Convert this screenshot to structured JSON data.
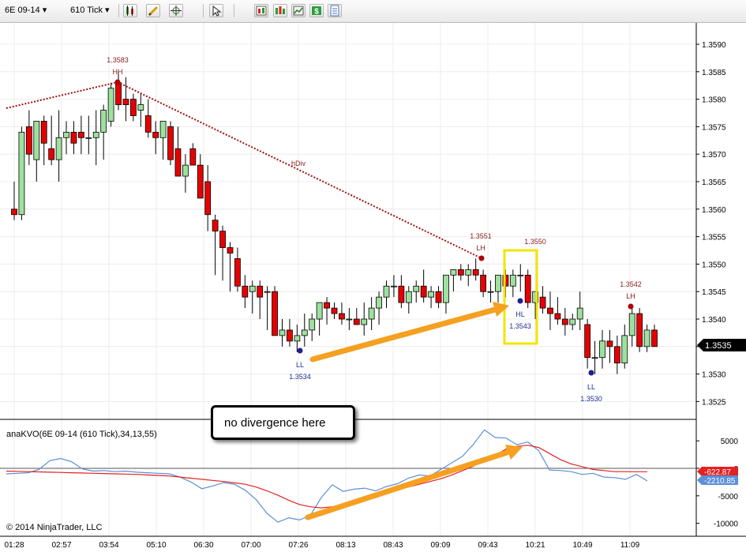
{
  "toolbar": {
    "instrument": "6E 09-14",
    "interval": "610 Tick",
    "icons": [
      "bars-icon",
      "pencil-icon",
      "crosshair-icon",
      "cursor-icon",
      "properties-icon",
      "indicators-icon",
      "strategies-icon",
      "dollar-icon",
      "data-box-icon"
    ]
  },
  "price_axis": {
    "labels": [
      "1.3590",
      "1.3585",
      "1.3580",
      "1.3575",
      "1.3570",
      "1.3565",
      "1.3560",
      "1.3555",
      "1.3550",
      "1.3545",
      "1.3540",
      "1.3535",
      "1.3530",
      "1.3525"
    ],
    "last_price": "1.3535"
  },
  "time_axis": {
    "labels": [
      "01:28",
      "02:57",
      "03:54",
      "05:10",
      "06:30",
      "07:00",
      "07:26",
      "08:13",
      "08:43",
      "09:09",
      "09:43",
      "10:21",
      "10:49",
      "11:09"
    ]
  },
  "indicator": {
    "title": "anaKVO(6E 09-14 (610 Tick),34,13,55)",
    "axis_labels": [
      "5000",
      "0",
      "-5000",
      "-10000"
    ],
    "value_tags": [
      "-622.87",
      "-2210.85"
    ]
  },
  "copyright": "© 2014 NinjaTrader, LLC",
  "callout_text": "no divergence here",
  "annotations": {
    "hh": {
      "value": "1.3583",
      "tag": "HH"
    },
    "ll1": {
      "value": "1.3534",
      "tag": "LL"
    },
    "lh1": {
      "value": "1.3551",
      "tag": "LH"
    },
    "lh2": {
      "value": "1.3550",
      "tag": ""
    },
    "hl": {
      "value": "1.3543",
      "tag": "HL"
    },
    "ll2": {
      "value": "1.3530",
      "tag": "LL"
    },
    "lh3": {
      "value": "1.3542",
      "tag": "LH"
    },
    "div": "hDiv"
  },
  "colors": {
    "up": "#9fe09f",
    "down": "#e60000",
    "kvo": "#5b8fd9",
    "signal": "#e32222",
    "arrow": "#f5a020",
    "highlight": "#f4e400",
    "hh_marker": "#b00000",
    "ll_marker": "#1f1f8f",
    "div_line": "#a01010"
  },
  "chart_data": [
    {
      "type": "candlestick",
      "title": "6E 09-14 610 Tick",
      "ylim": [
        1.3521,
        1.3593
      ],
      "candles": [
        [
          1.356,
          1.3565,
          1.3558,
          1.3559
        ],
        [
          1.3559,
          1.3575,
          1.3558,
          1.3574
        ],
        [
          1.3575,
          1.3578,
          1.3568,
          1.357
        ],
        [
          1.3569,
          1.3576,
          1.3565,
          1.3576
        ],
        [
          1.3576,
          1.3577,
          1.3568,
          1.3572
        ],
        [
          1.3571,
          1.3577,
          1.3568,
          1.3569
        ],
        [
          1.3569,
          1.3578,
          1.3565,
          1.3573
        ],
        [
          1.3573,
          1.3576,
          1.357,
          1.3574
        ],
        [
          1.3574,
          1.3576,
          1.357,
          1.3572
        ],
        [
          1.3574,
          1.3577,
          1.357,
          1.3573
        ],
        [
          1.3573,
          1.3577,
          1.357,
          1.3573
        ],
        [
          1.3573,
          1.3578,
          1.3568,
          1.3574
        ],
        [
          1.3574,
          1.3579,
          1.3569,
          1.3578
        ],
        [
          1.3576,
          1.3583,
          1.3575,
          1.3582
        ],
        [
          1.3583,
          1.3585,
          1.3578,
          1.3579
        ],
        [
          1.358,
          1.3584,
          1.3576,
          1.3579
        ],
        [
          1.358,
          1.3581,
          1.3576,
          1.3577
        ],
        [
          1.3578,
          1.3581,
          1.3575,
          1.3579
        ],
        [
          1.3577,
          1.358,
          1.3573,
          1.3574
        ],
        [
          1.3574,
          1.3576,
          1.357,
          1.3573
        ],
        [
          1.3573,
          1.3576,
          1.3569,
          1.3576
        ],
        [
          1.3575,
          1.3576,
          1.3568,
          1.3569
        ],
        [
          1.3571,
          1.3575,
          1.3566,
          1.3566
        ],
        [
          1.3566,
          1.357,
          1.3563,
          1.3568
        ],
        [
          1.3571,
          1.3572,
          1.3569,
          1.3568
        ],
        [
          1.3568,
          1.357,
          1.3565,
          1.3562
        ],
        [
          1.3565,
          1.3568,
          1.3556,
          1.3559
        ],
        [
          1.3558,
          1.3559,
          1.3548,
          1.3556
        ],
        [
          1.3556,
          1.3557,
          1.3547,
          1.3553
        ],
        [
          1.3553,
          1.3554,
          1.3545,
          1.3552
        ],
        [
          1.3551,
          1.3553,
          1.3545,
          1.3546
        ],
        [
          1.3546,
          1.3548,
          1.3542,
          1.3544
        ],
        [
          1.3545,
          1.3547,
          1.3541,
          1.3546
        ],
        [
          1.3546,
          1.3547,
          1.354,
          1.3544
        ],
        [
          1.3545,
          1.3546,
          1.3538,
          1.3545
        ],
        [
          1.3545,
          1.3546,
          1.3538,
          1.3537
        ],
        [
          1.3537,
          1.354,
          1.3535,
          1.3538
        ],
        [
          1.3538,
          1.354,
          1.3535,
          1.3536
        ],
        [
          1.3536,
          1.3539,
          1.3534,
          1.3537
        ],
        [
          1.3537,
          1.3541,
          1.3535,
          1.3538
        ],
        [
          1.3538,
          1.3541,
          1.3536,
          1.354
        ],
        [
          1.354,
          1.3543,
          1.3537,
          1.3543
        ],
        [
          1.3543,
          1.3544,
          1.3539,
          1.3542
        ],
        [
          1.3542,
          1.3543,
          1.354,
          1.3541
        ],
        [
          1.3541,
          1.3543,
          1.3539,
          1.354
        ],
        [
          1.354,
          1.3542,
          1.3538,
          1.354
        ],
        [
          1.354,
          1.3542,
          1.3539,
          1.3539
        ],
        [
          1.3539,
          1.3543,
          1.3537,
          1.354
        ],
        [
          1.354,
          1.3544,
          1.3538,
          1.3542
        ],
        [
          1.3542,
          1.3545,
          1.3539,
          1.3544
        ],
        [
          1.3544,
          1.3547,
          1.3542,
          1.3546
        ],
        [
          1.3546,
          1.3548,
          1.3544,
          1.3546
        ],
        [
          1.3546,
          1.3548,
          1.3542,
          1.3543
        ],
        [
          1.3543,
          1.3546,
          1.3541,
          1.3545
        ],
        [
          1.3545,
          1.3547,
          1.3543,
          1.3546
        ],
        [
          1.3546,
          1.3549,
          1.3543,
          1.3544
        ],
        [
          1.3544,
          1.3546,
          1.3542,
          1.3545
        ],
        [
          1.3545,
          1.3546,
          1.3542,
          1.3543
        ],
        [
          1.3543,
          1.3548,
          1.3541,
          1.3548
        ],
        [
          1.3548,
          1.3549,
          1.3545,
          1.3549
        ],
        [
          1.3549,
          1.355,
          1.3547,
          1.3548
        ],
        [
          1.3548,
          1.355,
          1.3546,
          1.3549
        ],
        [
          1.3549,
          1.3551,
          1.3547,
          1.3548
        ],
        [
          1.3548,
          1.3549,
          1.3544,
          1.3545
        ],
        [
          1.3545,
          1.3547,
          1.3543,
          1.3545
        ],
        [
          1.3545,
          1.3548,
          1.3543,
          1.3548
        ],
        [
          1.3548,
          1.3549,
          1.3544,
          1.3546
        ],
        [
          1.3546,
          1.3549,
          1.3544,
          1.3548
        ],
        [
          1.3548,
          1.355,
          1.3545,
          1.3548
        ],
        [
          1.3548,
          1.3549,
          1.3542,
          1.3543
        ],
        [
          1.3543,
          1.3545,
          1.354,
          1.3545
        ],
        [
          1.3544,
          1.3546,
          1.3541,
          1.3542
        ],
        [
          1.3542,
          1.3545,
          1.3538,
          1.3541
        ],
        [
          1.3541,
          1.3544,
          1.3539,
          1.354
        ],
        [
          1.354,
          1.3542,
          1.3537,
          1.3539
        ],
        [
          1.3539,
          1.3541,
          1.3538,
          1.354
        ],
        [
          1.354,
          1.3545,
          1.3538,
          1.3542
        ],
        [
          1.3539,
          1.354,
          1.3531,
          1.3533
        ],
        [
          1.3533,
          1.3536,
          1.353,
          1.3533
        ],
        [
          1.3533,
          1.3538,
          1.3531,
          1.3536
        ],
        [
          1.3536,
          1.3538,
          1.3532,
          1.3535
        ],
        [
          1.3535,
          1.3537,
          1.353,
          1.3532
        ],
        [
          1.3532,
          1.3539,
          1.3531,
          1.3537
        ],
        [
          1.3537,
          1.3542,
          1.3535,
          1.3541
        ],
        [
          1.3541,
          1.3542,
          1.3534,
          1.3535
        ],
        [
          1.3535,
          1.3539,
          1.3534,
          1.3538
        ],
        [
          1.3538,
          1.3539,
          1.3535,
          1.3535
        ]
      ]
    },
    {
      "type": "line",
      "title": "anaKVO(6E 09-14 (610 Tick),34,13,55)",
      "ylim": [
        -10700,
        8300
      ],
      "series": [
        {
          "values": [
            -1000,
            -900,
            -800,
            -200,
            1400,
            1800,
            1200,
            -100,
            -500,
            -400,
            -600,
            -500,
            -700,
            -800,
            -900,
            -1000,
            -1600,
            -2500,
            -3700,
            -3200,
            -2600,
            -2900,
            -4000,
            -5700,
            -8200,
            -9800,
            -9000,
            -9400,
            -8500,
            -5300,
            -3000,
            -4200,
            -3800,
            -3600,
            -4100,
            -3300,
            -2800,
            -1800,
            -1200,
            -1400,
            -200,
            1000,
            2200,
            4400,
            7000,
            5600,
            5500,
            4300,
            4800,
            3200,
            -300,
            -400,
            -600,
            -1100,
            -900,
            -1600,
            -1700,
            -2000,
            -1100,
            -2300
          ]
        },
        {
          "values": [
            -500,
            -550,
            -600,
            -650,
            -700,
            -750,
            -800,
            -850,
            -900,
            -950,
            -1000,
            -1050,
            -1100,
            -1200,
            -1300,
            -1400,
            -1600,
            -1800,
            -2000,
            -2200,
            -2400,
            -2650,
            -2900,
            -3400,
            -4100,
            -4900,
            -5800,
            -6600,
            -7000,
            -7200,
            -7000,
            -6600,
            -6200,
            -5700,
            -5100,
            -4500,
            -3900,
            -3400,
            -2900,
            -2400,
            -1900,
            -1200,
            -400,
            400,
            1500,
            2400,
            3500,
            4000,
            4200,
            3800,
            2700,
            1600,
            800,
            300,
            -200,
            -400,
            -600,
            -600,
            -620,
            -623
          ]
        }
      ]
    }
  ]
}
